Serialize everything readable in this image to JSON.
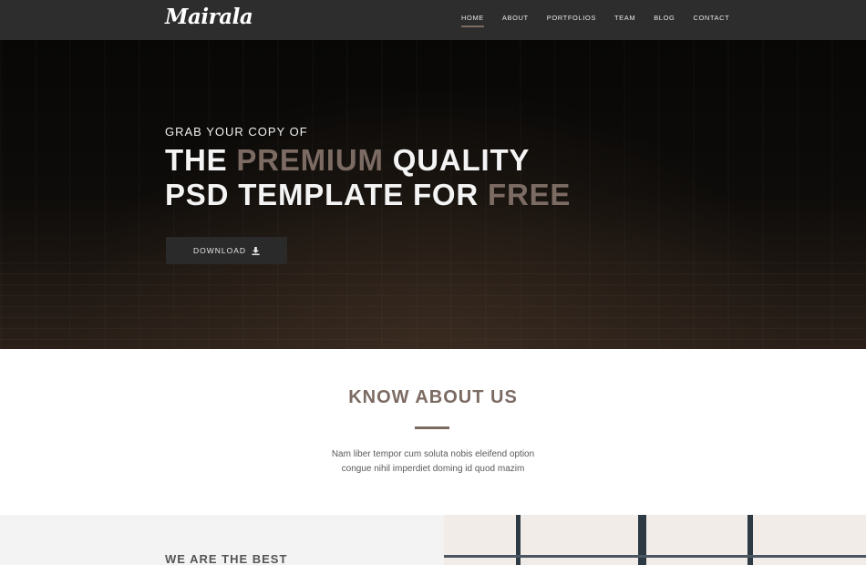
{
  "brand": {
    "logo": "Mairala"
  },
  "nav": {
    "items": [
      {
        "label": "HOME",
        "active": true
      },
      {
        "label": "ABOUT",
        "active": false
      },
      {
        "label": "PORTFOLIOS",
        "active": false
      },
      {
        "label": "TEAM",
        "active": false
      },
      {
        "label": "BLOG",
        "active": false
      },
      {
        "label": "CONTACT",
        "active": false
      }
    ]
  },
  "hero": {
    "kicker": "GRAB YOUR COPY OF",
    "title_line1": {
      "before": "THE ",
      "accent": "PREMIUM",
      "after": " QUALITY"
    },
    "title_line2": {
      "before": "PSD TEMPLATE FOR ",
      "accent": "FREE"
    },
    "button_label": "DOWNLOAD",
    "button_icon": "download-icon"
  },
  "about": {
    "title": "KNOW ABOUT US",
    "text_line1": "Nam liber tempor cum soluta nobis eleifend option",
    "text_line2": "congue nihil imperdiet doming id quod mazim"
  },
  "section2": {
    "title": "WE ARE THE BEST"
  },
  "colors": {
    "accent": "#7b6b63",
    "navbar": "#2d2d2d",
    "button": "#2a2a2a"
  }
}
